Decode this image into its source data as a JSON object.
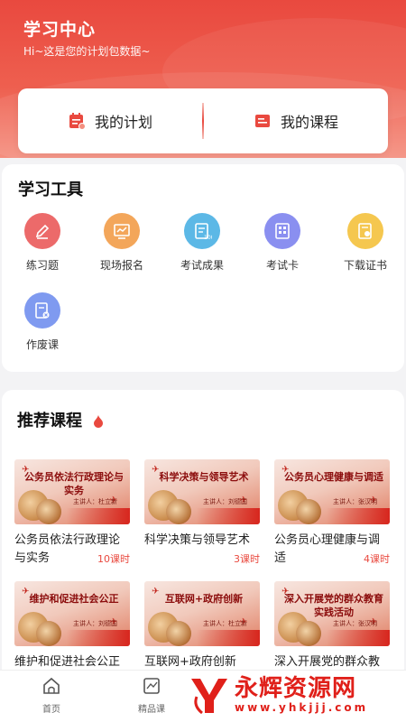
{
  "header": {
    "title": "学习中心",
    "subtitle": "Hi~这是您的计划包数据~"
  },
  "plan": {
    "my_plan": "我的计划",
    "my_courses": "我的课程"
  },
  "tools": {
    "title": "学习工具",
    "items": [
      {
        "label": "练习题",
        "icon": "pencil-icon",
        "color": "#ec6a6a"
      },
      {
        "label": "现场报名",
        "icon": "chart-board-icon",
        "color": "#f3a65a"
      },
      {
        "label": "考试成果",
        "icon": "exam-result-icon",
        "color": "#5cb8e6"
      },
      {
        "label": "考试卡",
        "icon": "exam-card-icon",
        "color": "#8a8ff0"
      },
      {
        "label": "下载证书",
        "icon": "certificate-icon",
        "color": "#f5c74f"
      },
      {
        "label": "作废课",
        "icon": "void-course-icon",
        "color": "#7f9af0"
      }
    ]
  },
  "recommend": {
    "title": "推荐课程",
    "courses": [
      {
        "thumb_text": "公务员依法行政理论与实务",
        "speaker": "主讲人：杜立新",
        "title": "公务员依法行政理论与实务",
        "hours": "10课时"
      },
      {
        "thumb_text": "科学决策与领导艺术",
        "speaker": "主讲人：刘德国",
        "title": "科学决策与领导艺术",
        "hours": "3课时"
      },
      {
        "thumb_text": "公务员心理健康与调适",
        "speaker": "主讲人：张汉明",
        "title": "公务员心理健康与调适",
        "hours": "4课时"
      },
      {
        "thumb_text": "维护和促进社会公正",
        "speaker": "主讲人：刘德国",
        "title": "维护和促进社会公正",
        "hours": ""
      },
      {
        "thumb_text": "互联网+政府创新",
        "speaker": "主讲人：杜立新",
        "title": "互联网+政府创新",
        "hours": ""
      },
      {
        "thumb_text": "深入开展党的群众教育实践活动",
        "speaker": "主讲人：张汉明",
        "title": "深入开展党的群众教",
        "hours": ""
      }
    ]
  },
  "tabbar": {
    "items": [
      {
        "label": "首页",
        "icon": "home-icon"
      },
      {
        "label": "精品课",
        "icon": "trend-icon"
      }
    ]
  },
  "watermark": {
    "name": "永辉资源网",
    "url": "www.yhkjjj.com"
  },
  "colors": {
    "accent": "#e9493f"
  }
}
